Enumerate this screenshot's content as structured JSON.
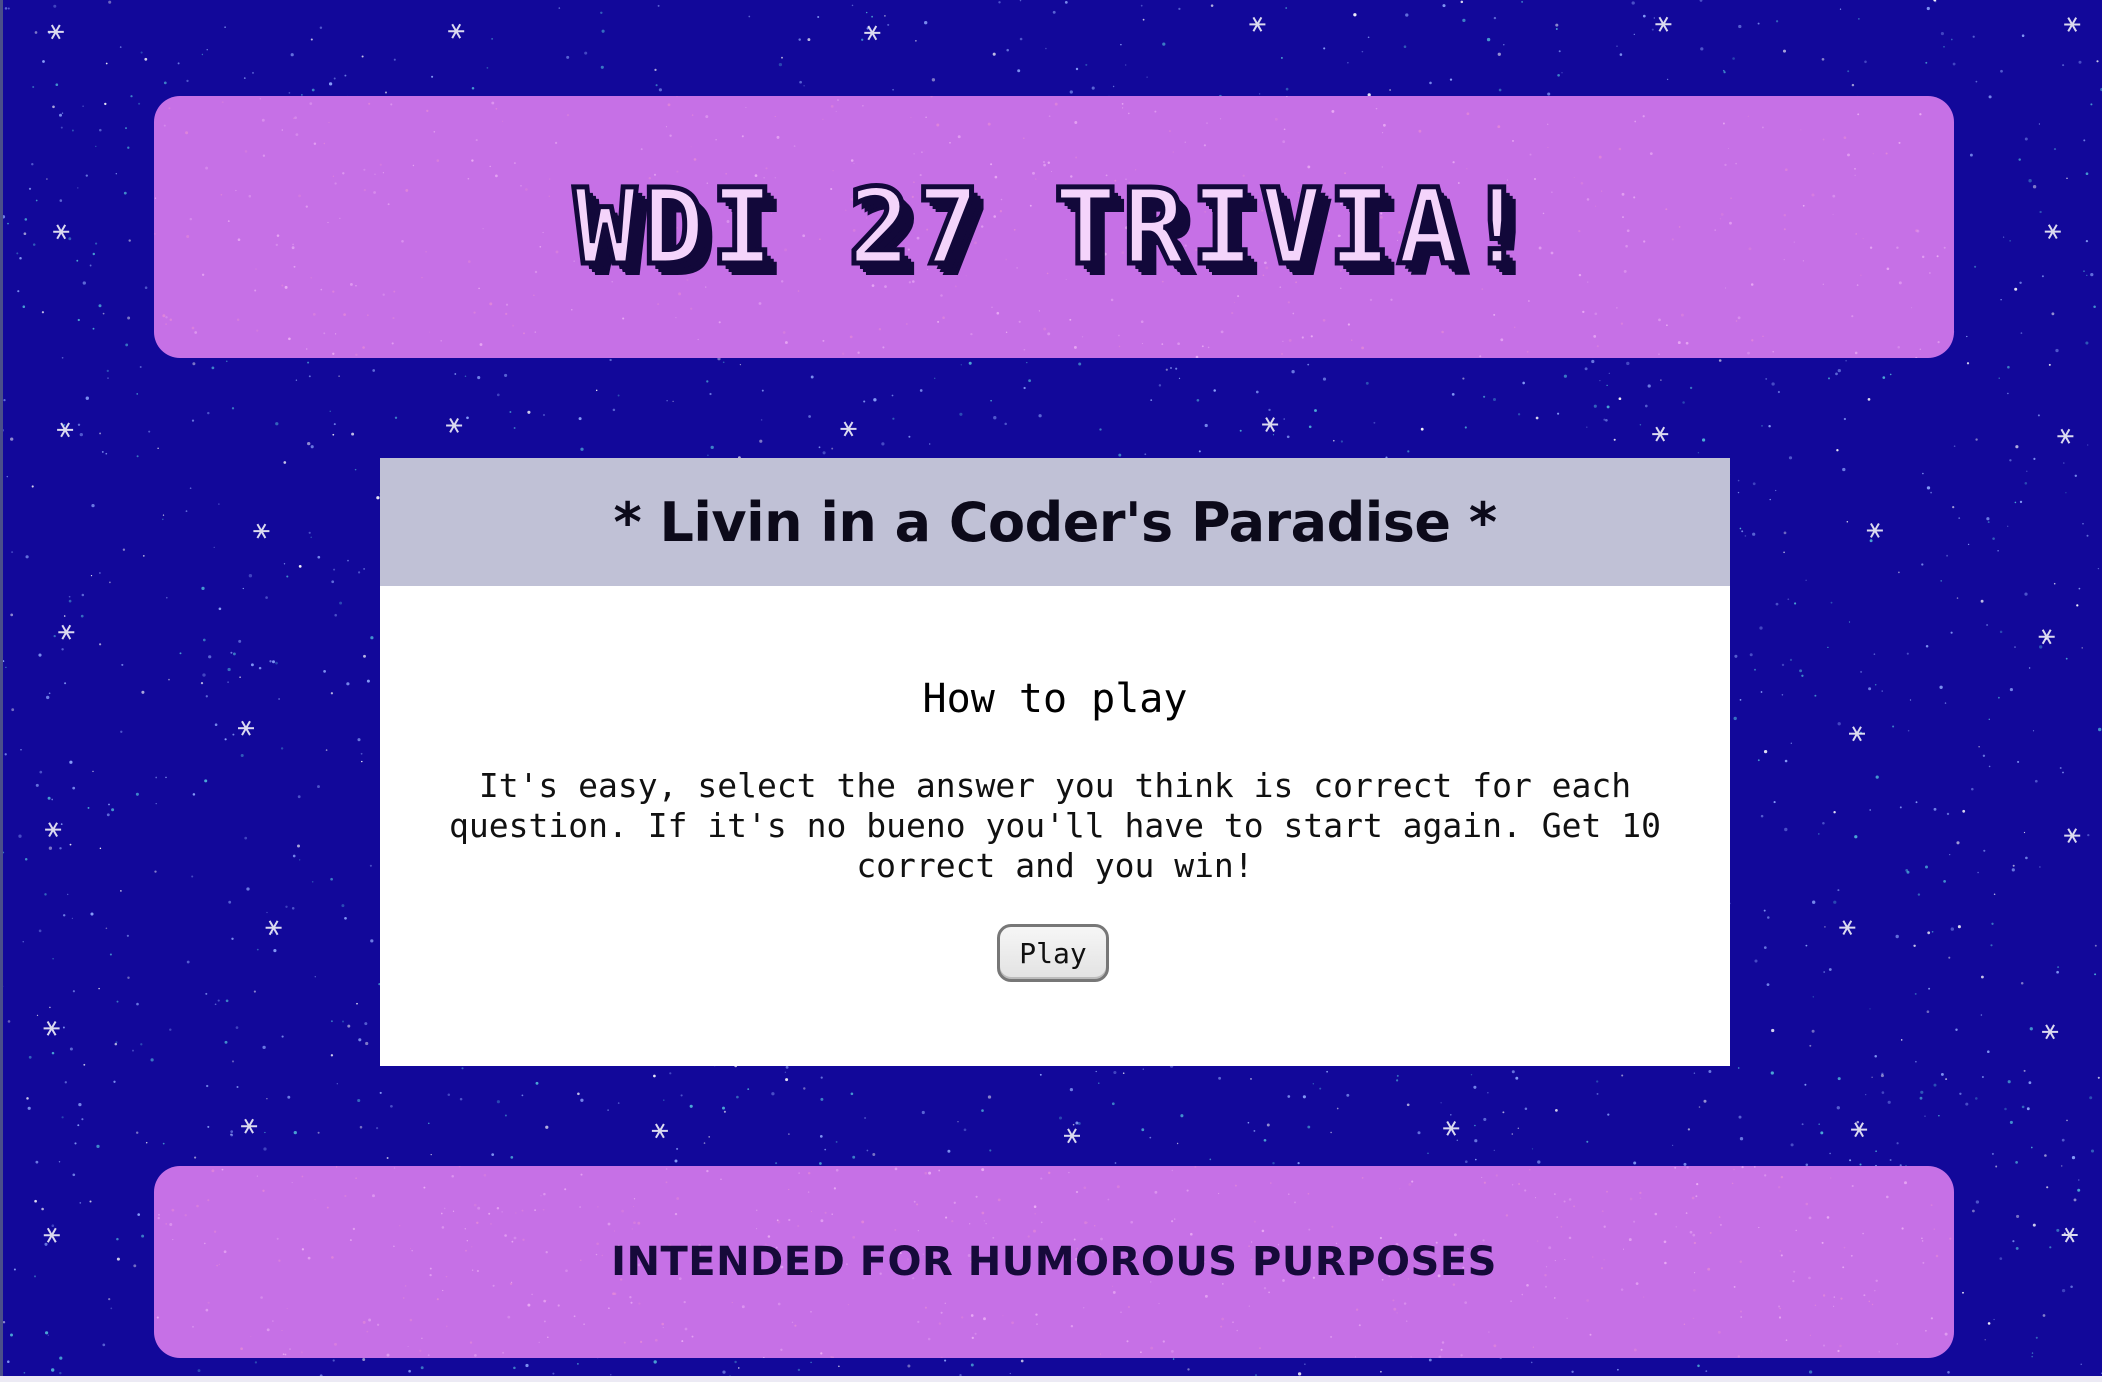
{
  "header": {
    "title": "WDI 27 TRIVIA!"
  },
  "card": {
    "title": "* Livin in a Coder's Paradise *",
    "heading": "How to play",
    "instructions": "It's easy, select the answer you think is correct for each question. If it's no bueno you'll have to start again. Get 10 correct and you win!",
    "play_label": "Play"
  },
  "footer": {
    "text": "INTENDED FOR HUMOROUS PURPOSES"
  },
  "colors": {
    "background": "#12089a",
    "banner": "#c670e6",
    "card_header": "#c0c1d6",
    "card_body": "#ffffff",
    "title_outline": "#12083a"
  }
}
